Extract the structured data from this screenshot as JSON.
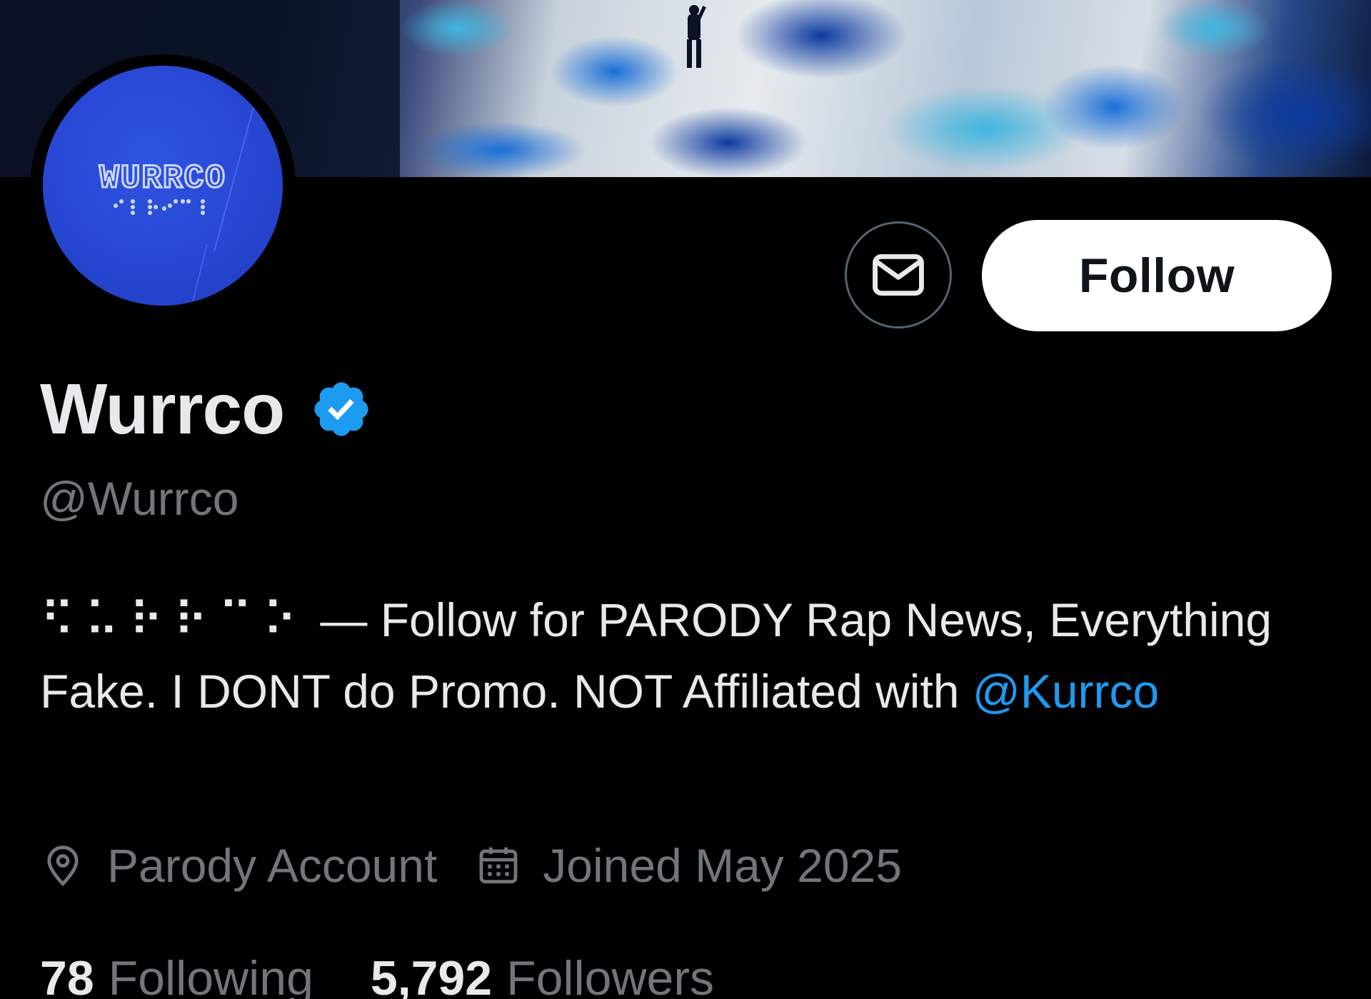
{
  "profile": {
    "avatar_text": "WURRCO",
    "display_name": "Wurrco",
    "handle": "@Wurrco",
    "verified_badge": "verified-check-icon",
    "follow_label": "Follow",
    "message_icon": "envelope-icon"
  },
  "bio": {
    "braille": "⠫⠥⠗⠗⠉⠕",
    "dash": " — ",
    "line_text": "Follow for PARODY Rap News, Everything Fake. I DONT do Promo. NOT Affiliated with ",
    "mention": "@Kurrco"
  },
  "meta": {
    "location_icon": "location-pin-icon",
    "location": "Parody Account",
    "joined_icon": "calendar-icon",
    "joined": "Joined May 2025"
  },
  "stats": {
    "following_count": "78",
    "following_label": "Following",
    "followers_count": "5,792",
    "followers_label": "Followers"
  },
  "colors": {
    "background": "#000000",
    "primary_text": "#e7e9ea",
    "secondary_text": "#71767b",
    "link": "#1d9bf0",
    "verified": "#1d9bf0",
    "avatar_bg": "#2747d3"
  }
}
